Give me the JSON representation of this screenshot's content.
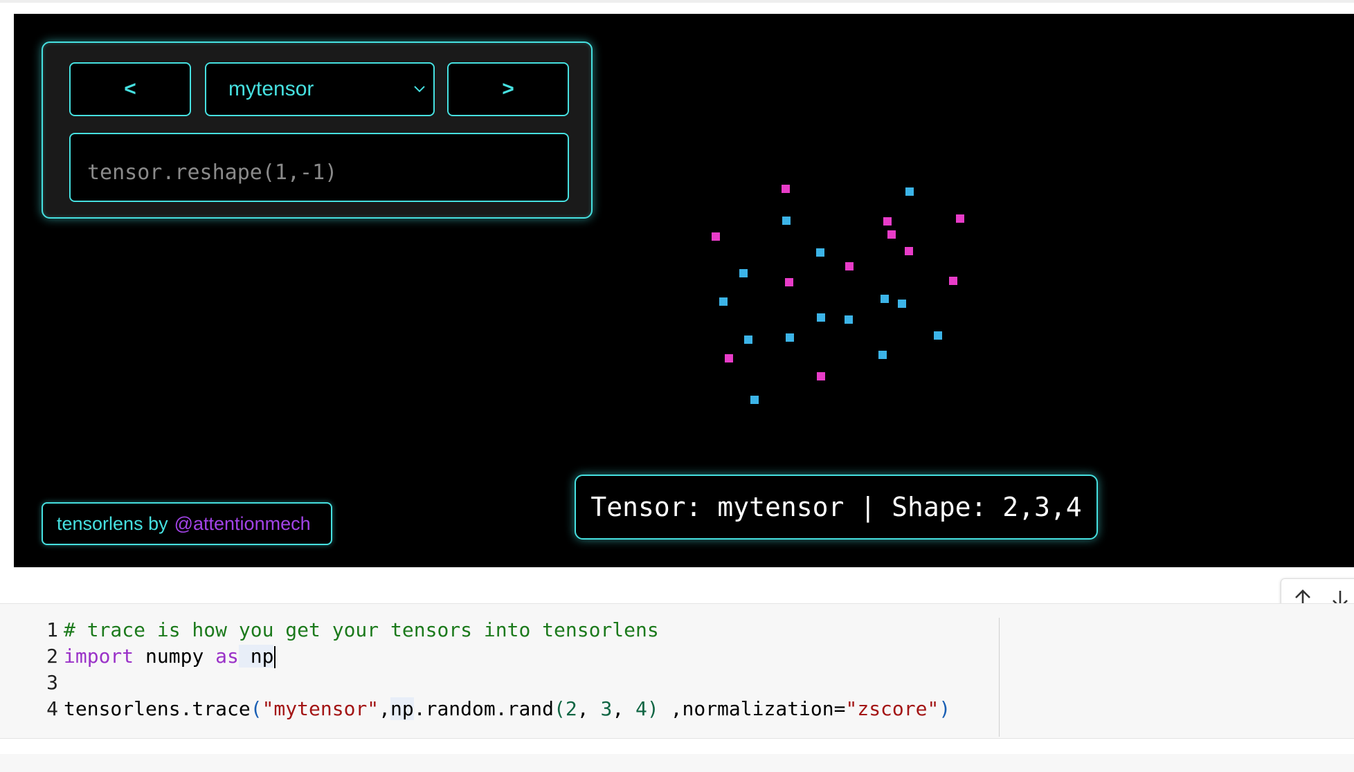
{
  "controls": {
    "prev_label": "<",
    "next_label": ">",
    "selected_tensor": "mytensor",
    "expression_placeholder": "tensor.reshape(1,-1)"
  },
  "colors": {
    "accent_cyan": "#46e0e0",
    "point_blue": "#3cb4e8",
    "point_magenta": "#e83cc8",
    "credit_link": "#a243e6"
  },
  "credit": {
    "text": "tensorlens by",
    "handle": "@attentionmech"
  },
  "info_bar": {
    "text": "Tensor: mytensor | Shape: 2,3,4"
  },
  "cell_toolbar": {
    "up_icon": "arrow-up-icon",
    "down_icon": "arrow-down-icon"
  },
  "code": {
    "lines": [
      {
        "number": "1",
        "comment": "# trace is how you get your tensors into tensorlens"
      },
      {
        "number": "2",
        "kw_import": "import",
        "module": " numpy ",
        "kw_as": "as",
        "alias": " np"
      },
      {
        "number": "3"
      },
      {
        "number": "4",
        "fn": "tensorlens.trace",
        "open_paren": "(",
        "arg_name": "\"mytensor\"",
        "comma1": ",",
        "np_ref": "np",
        "call": ".random.rand",
        "inner_open": "(",
        "n1": "2",
        "sep1": ", ",
        "n2": "3",
        "sep2": ", ",
        "n3": "4",
        "inner_close": ")",
        "kwarg": " ,normalization=",
        "kwarg_val": "\"zscore\"",
        "close_paren": ")"
      }
    ]
  }
}
